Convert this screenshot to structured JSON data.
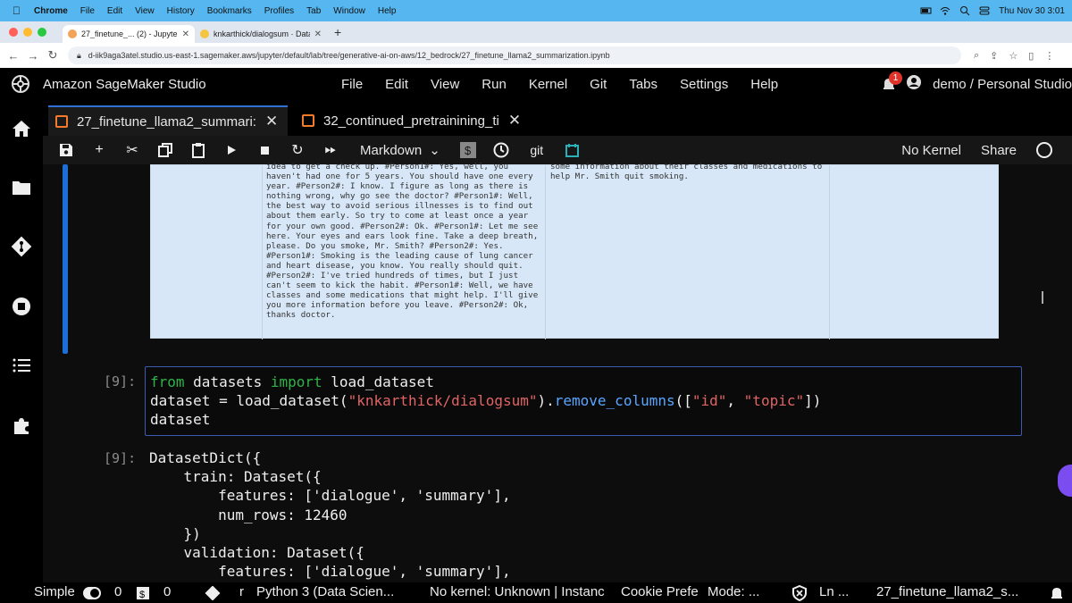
{
  "macbar": {
    "app": "Chrome",
    "menus": [
      "File",
      "Edit",
      "View",
      "History",
      "Bookmarks",
      "Profiles",
      "Tab",
      "Window",
      "Help"
    ],
    "clock": "Thu Nov 30  3:01"
  },
  "browser": {
    "tabs": [
      {
        "title": "27_finetune_... (2) - JupyterL",
        "active": true
      },
      {
        "title": "knkarthick/dialogsum · Datas",
        "active": false
      }
    ],
    "url": "d-iik9aga3atel.studio.us-east-1.sagemaker.aws/jupyter/default/lab/tree/generative-ai-on-aws/12_bedrock/27_finetune_llama2_summarization.ipynb"
  },
  "studio": {
    "title": "Amazon SageMaker Studio",
    "menus": [
      "File",
      "Edit",
      "View",
      "Run",
      "Kernel",
      "Git",
      "Tabs",
      "Settings",
      "Help"
    ],
    "notification_count": "1",
    "user": "demo / Personal Studio"
  },
  "notebook_tabs": [
    {
      "label": "27_finetune_llama2_summari:",
      "active": true
    },
    {
      "label": "32_continued_pretrainining_ti",
      "active": false
    }
  ],
  "toolbar": {
    "cell_type": "Markdown",
    "git": "git",
    "kernel": "No Kernel",
    "share": "Share"
  },
  "output_table": {
    "dialogue_lines": [
      "idea to get a check up. #Person1#: Yes, well, you",
      "haven't had one for 5 years. You should have one every",
      "year. #Person2#: I know. I figure as long as there is",
      "nothing wrong, why go see the doctor? #Person1#: Well,",
      "the best way to avoid serious illnesses is to find out",
      "about them early. So try to come at least once a year",
      "for your own good. #Person2#: Ok. #Person1#: Let me see",
      "here. Your eyes and ears look fine. Take a deep breath,",
      "please. Do you smoke, Mr. Smith? #Person2#: Yes.",
      "#Person1#: Smoking is the leading cause of lung cancer",
      "and heart disease, you know. You really should quit.",
      "#Person2#: I've tried hundreds of times, but I just",
      "can't seem to kick the habit. #Person1#: Well, we have",
      "classes and some medications that might help. I'll give",
      "you more information before you leave. #Person2#: Ok,",
      "thanks doctor."
    ],
    "summary_lines": [
      "some information about their classes and medications to",
      "help Mr. Smith quit smoking."
    ]
  },
  "code_cell": {
    "prompt": "[9]:",
    "line1_kw1": "from",
    "line1_mod": " datasets ",
    "line1_kw2": "import",
    "line1_rest": " load_dataset",
    "line2_a": "dataset = load_dataset(",
    "line2_str": "\"knkarthick/dialogsum\"",
    "line2_b": ").",
    "line2_fn": "remove_columns",
    "line2_c": "([",
    "line2_str2": "\"id\"",
    "line2_d": ", ",
    "line2_str3": "\"topic\"",
    "line2_e": "])",
    "line3": "dataset"
  },
  "output_cell": {
    "prompt": "[9]:",
    "text": "DatasetDict({\n    train: Dataset({\n        features: ['dialogue', 'summary'],\n        num_rows: 12460\n    })\n    validation: Dataset({\n        features: ['dialogue', 'summary'],"
  },
  "statusbar": {
    "mode": "Simple",
    "count1": "0",
    "count2": "0",
    "git_branch": "r",
    "kernel_name": "Python 3 (Data Scien...",
    "kernel_status": "No kernel: Unknown | Instanc",
    "cookie": "Cookie Prefe",
    "edit_mode": "Mode: ...",
    "ln": "Ln ...",
    "filename": "27_finetune_llama2_s..."
  }
}
